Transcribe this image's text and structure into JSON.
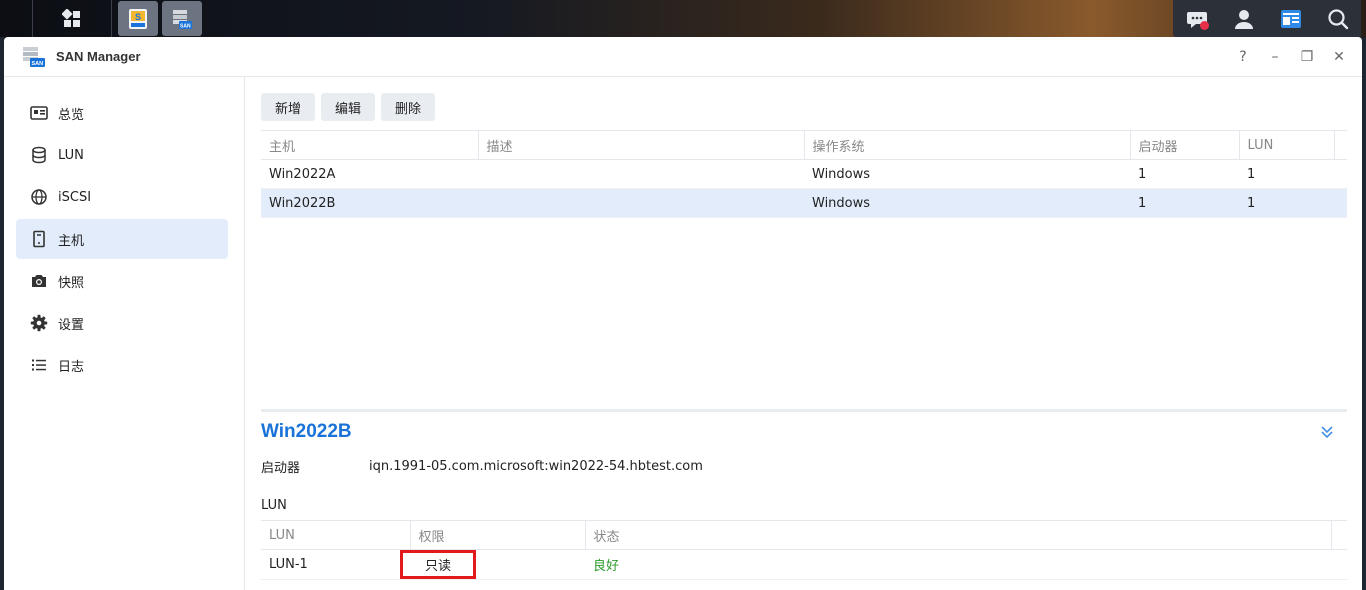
{
  "window": {
    "title": "SAN Manager"
  },
  "window_controls": {
    "help": "?",
    "minimize": "–",
    "restore": "❐",
    "close": "✕"
  },
  "sidebar": {
    "items": [
      {
        "label": "总览",
        "icon": "overview-icon"
      },
      {
        "label": "LUN",
        "icon": "database-icon"
      },
      {
        "label": "iSCSI",
        "icon": "globe-icon"
      },
      {
        "label": "主机",
        "icon": "host-icon",
        "active": true
      },
      {
        "label": "快照",
        "icon": "camera-icon"
      },
      {
        "label": "设置",
        "icon": "gear-icon"
      },
      {
        "label": "日志",
        "icon": "list-icon"
      }
    ]
  },
  "toolbar": {
    "add": "新增",
    "edit": "编辑",
    "delete": "删除"
  },
  "hosts_table": {
    "columns": [
      "主机",
      "描述",
      "操作系统",
      "启动器",
      "LUN"
    ],
    "rows": [
      [
        "Win2022A",
        "",
        "Windows",
        "1",
        "1"
      ],
      [
        "Win2022B",
        "",
        "Windows",
        "1",
        "1"
      ]
    ],
    "selected_row": 1
  },
  "detail": {
    "title": "Win2022B",
    "initiator_label": "启动器",
    "initiator_value": "iqn.1991-05.com.microsoft:win2022-54.hbtest.com",
    "lun_section_label": "LUN",
    "lun_table": {
      "columns": [
        "LUN",
        "权限",
        "状态"
      ],
      "rows": [
        [
          "LUN-1",
          "只读",
          "良好"
        ]
      ]
    }
  },
  "colors": {
    "accent": "#1a73d9",
    "selected_bg": "#e2ecfb",
    "status_good": "#2b9a2b",
    "highlight_box": "#e11b1b"
  }
}
